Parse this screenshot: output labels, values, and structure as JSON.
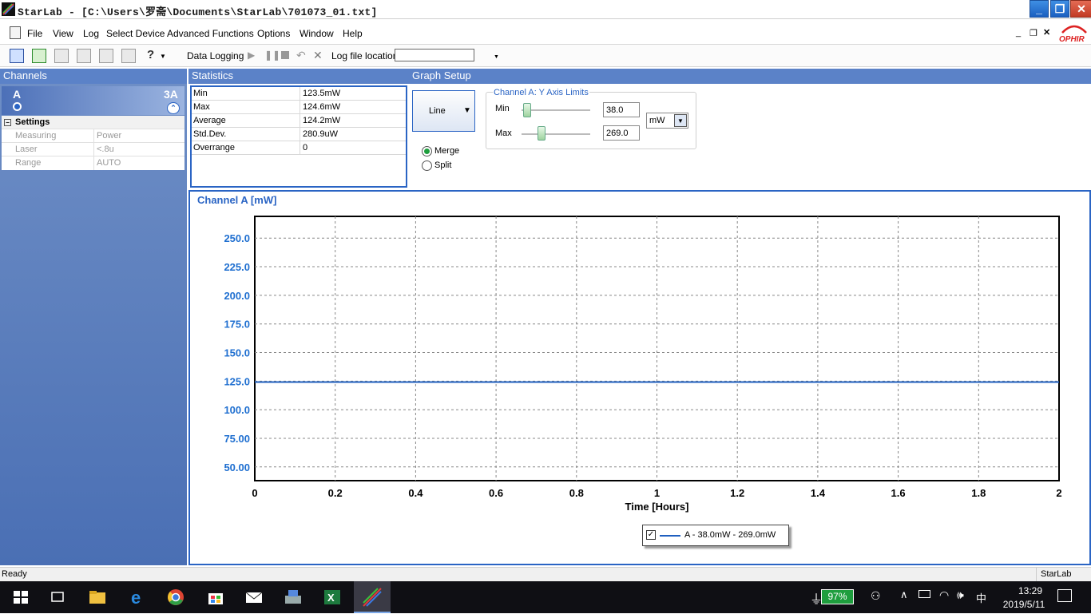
{
  "window": {
    "title": "StarLab - [C:\\Users\\罗斋\\Documents\\StarLab\\701073_01.txt]",
    "minimize": "_",
    "maximize": "❐",
    "close": "✕"
  },
  "menu": [
    "File",
    "View",
    "Log",
    "Select Device",
    "Advanced Functions",
    "Options",
    "Window",
    "Help"
  ],
  "mdi_controls": {
    "minimize": "_",
    "restore": "❐",
    "close": "✕"
  },
  "brand": "OPHIR",
  "toolbar": {
    "data_logging": "Data Logging",
    "log_file_label": "Log file location",
    "log_file_value": ""
  },
  "channels": {
    "header": "Channels",
    "channel_letter": "A",
    "channel_range": "3A",
    "settings_title": "Settings",
    "settings": [
      {
        "key": "Measuring",
        "value": "Power"
      },
      {
        "key": "Laser",
        "value": "<.8u"
      },
      {
        "key": "Range",
        "value": "AUTO"
      }
    ]
  },
  "statistics": {
    "header": "Statistics",
    "rows": [
      {
        "key": "Min",
        "value": "123.5mW"
      },
      {
        "key": "Max",
        "value": "124.6mW"
      },
      {
        "key": "Average",
        "value": "124.2mW"
      },
      {
        "key": "Std.Dev.",
        "value": "280.9uW"
      },
      {
        "key": "Overrange",
        "value": "0"
      }
    ]
  },
  "graph_setup": {
    "header": "Graph Setup",
    "graph_type": "Line",
    "merge_label": "Merge",
    "split_label": "Split",
    "merge_selected": true,
    "y_limits_title": "Channel A: Y Axis Limits",
    "min_label": "Min",
    "min_value": "38.0",
    "max_label": "Max",
    "max_value": "269.0",
    "unit": "mW"
  },
  "chart_data": {
    "type": "line",
    "title": "Channel A [mW]",
    "xlabel": "Time [Hours]",
    "ylabel": "",
    "xlim": [
      0,
      2
    ],
    "ylim": [
      38,
      269
    ],
    "x_ticks": [
      "0",
      "0.2",
      "0.4",
      "0.6",
      "0.8",
      "1",
      "1.2",
      "1.4",
      "1.6",
      "1.8",
      "2"
    ],
    "y_ticks": [
      "50.00",
      "75.00",
      "100.0",
      "125.0",
      "150.0",
      "175.0",
      "200.0",
      "225.0",
      "250.0"
    ],
    "grid": true,
    "series": [
      {
        "name": "A - 38.0mW - 269.0mW",
        "color": "#1f5fbf",
        "x": [
          0,
          0.5,
          0.9,
          2
        ],
        "y": [
          124.2,
          124.2,
          124.2,
          124.2
        ]
      }
    ],
    "legend_checked": true,
    "legend_placement": "bottom-center"
  },
  "status": {
    "left": "Ready",
    "right": "StarLab"
  },
  "taskbar": {
    "battery": "97%",
    "ime": "中",
    "time": "13:29",
    "date": "2019/5/11"
  }
}
